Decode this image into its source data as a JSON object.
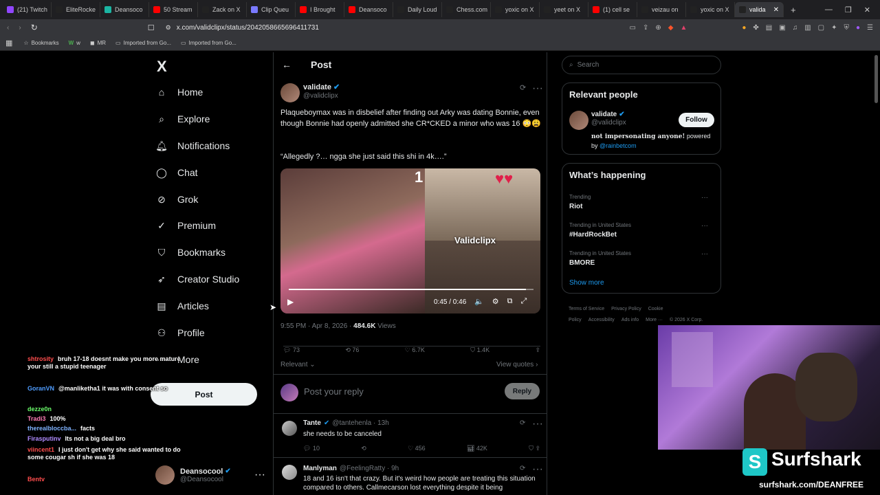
{
  "browser": {
    "tabs": [
      {
        "label": "(21) Twitch",
        "color": "#9146ff"
      },
      {
        "label": "EliteRocke",
        "color": "#222"
      },
      {
        "label": "Deansoco",
        "color": "#1bb5a3"
      },
      {
        "label": "50 Stream",
        "color": "#ff0000"
      },
      {
        "label": "Zack on X",
        "color": "#222"
      },
      {
        "label": "Clip Queu",
        "color": "#7a7aff"
      },
      {
        "label": "I Brought",
        "color": "#ff0000"
      },
      {
        "label": "Deansoco",
        "color": "#ff0000"
      },
      {
        "label": "Daily Loud",
        "color": "#222"
      },
      {
        "label": "Chess.com",
        "color": "#222"
      },
      {
        "label": "yoxic on X",
        "color": "#222"
      },
      {
        "label": "yeet on X",
        "color": "#222"
      },
      {
        "label": "(1) cell se",
        "color": "#ff0000"
      },
      {
        "label": "veizau on",
        "color": "#222"
      },
      {
        "label": "yoxic on X",
        "color": "#222"
      },
      {
        "label": "valida",
        "color": "#222"
      }
    ],
    "url": "x.com/validclipx/status/2042058665696411731",
    "bookmarks": [
      "Bookmarks",
      "w",
      "MR",
      "Imported from Go...",
      "Imported from Go..."
    ]
  },
  "sidebar": {
    "logo": "X",
    "items": [
      {
        "label": "Home",
        "icon": "home-icon"
      },
      {
        "label": "Explore",
        "icon": "search-icon"
      },
      {
        "label": "Notifications",
        "icon": "bell-icon"
      },
      {
        "label": "Chat",
        "icon": "chat-icon"
      },
      {
        "label": "Grok",
        "icon": "grok-icon"
      },
      {
        "label": "Premium",
        "icon": "premium-icon"
      },
      {
        "label": "Bookmarks",
        "icon": "bookmark-icon"
      },
      {
        "label": "Creator Studio",
        "icon": "rocket-icon"
      },
      {
        "label": "Articles",
        "icon": "article-icon"
      },
      {
        "label": "Profile",
        "icon": "profile-icon"
      },
      {
        "label": "More",
        "icon": "more-icon"
      }
    ],
    "post_label": "Post",
    "account": {
      "name": "Deansocool",
      "handle": "@Deansocool"
    }
  },
  "post": {
    "header": "Post",
    "author": {
      "name": "validate",
      "handle": "@validclipx"
    },
    "text": "Plaqueboymax was in disbelief after finding out Arky was dating Bonnie, even though Bonnie had openly admitted she CR*CKED a minor who was 16 😳😩",
    "quote": "“Allegedly ?… ngga she just said this shi in 4k….”",
    "video": {
      "time": "0:45 / 0:46",
      "watermark": "Validclipx",
      "progress": 0.97
    },
    "timestamp": "9:55 PM · Apr 8, 2026 · ",
    "views": "484.6K",
    "views_label": "Views",
    "stats": {
      "replies": "73",
      "reposts": "76",
      "likes": "6.7K",
      "bookmarks": "1.4K"
    },
    "sort": "Relevant",
    "view_quotes": "View quotes",
    "reply_placeholder": "Post your reply",
    "reply_button": "Reply"
  },
  "replies": [
    {
      "name": "Tante",
      "handle": "@tantehenla · 13h",
      "text": "she needs to be canceled",
      "replies": "10",
      "likes": "456",
      "views": "42K"
    },
    {
      "name": "Manlyman",
      "handle": "@FeelingRatty · 9h",
      "text": "18 and 16 isn't that crazy. But it's weird how people are treating this situation compared to others. Callmecarson lost everything despite it being"
    }
  ],
  "right": {
    "search_placeholder": "Search",
    "relevant_title": "Relevant people",
    "person": {
      "name": "validate",
      "handle": "@validclipx",
      "bio_a": "not impersonating anyone!",
      "bio_b": " powered by ",
      "bio_link": "@rainbetcom",
      "follow": "Follow"
    },
    "happening_title": "What’s happening",
    "trends": [
      {
        "context": "Trending",
        "name": "Riot"
      },
      {
        "context": "Trending in United States",
        "name": "#HardRockBet"
      },
      {
        "context": "Trending in United States",
        "name": "BMORE"
      }
    ],
    "show_more": "Show more",
    "footer": [
      "Terms of Service",
      "Privacy Policy",
      "Cookie Policy",
      "Accessibility",
      "Ads info",
      "More ···",
      "© 2026 X Corp."
    ]
  },
  "overlay": {
    "chat": [
      {
        "user": "shtrosity",
        "msg": "bruh 17-18 doesnt make you more mature your still a stupid teenager",
        "color": "#ff4d4d"
      },
      {
        "user": "GoranVN",
        "msg": "@manliketha1 it was with consent so",
        "color": "#4f9dff"
      },
      {
        "user": "dezze0n",
        "msg": "",
        "color": "#6cff6c"
      },
      {
        "user": "Tradi3",
        "msg": "100%",
        "color": "#ff7eb6"
      },
      {
        "user": "therealbloccba...",
        "msg": "facts",
        "color": "#7fb3ff"
      },
      {
        "user": "Firasputinv",
        "msg": "Its not a big deal bro",
        "color": "#b08cff"
      },
      {
        "user": "viincent1",
        "msg": "I just don't get why she said wanted to do some cougar sh if she was 18",
        "color": "#ff4d4d"
      },
      {
        "user": "Bentv",
        "msg": "",
        "color": "#ff4d4d"
      }
    ],
    "sponsor": "Surfshark",
    "sponsor_url": "surfshark.com/DEANFREE"
  }
}
